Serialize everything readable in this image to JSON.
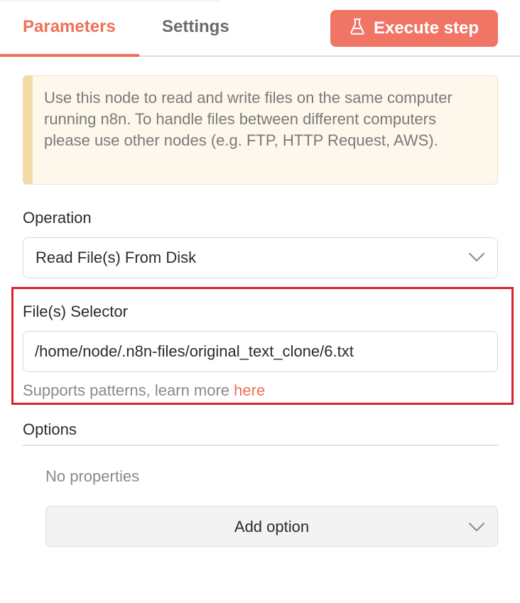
{
  "tabs": {
    "parameters": "Parameters",
    "settings": "Settings"
  },
  "execute_button": {
    "label": "Execute step",
    "icon": "flask-icon",
    "color": "#f07565"
  },
  "notice": {
    "text": "Use this node to read and write files on the same computer running n8n. To handle files between different computers please use other nodes (e.g. FTP, HTTP Request, AWS)."
  },
  "operation": {
    "label": "Operation",
    "value": "Read File(s) From Disk"
  },
  "file_selector": {
    "label": "File(s) Selector",
    "value": "/home/node/.n8n-files/original_text_clone/6.txt",
    "hint_prefix": "Supports patterns, learn more ",
    "hint_link": "here",
    "highlight_color": "#d9232f"
  },
  "options": {
    "label": "Options",
    "empty_text": "No properties",
    "add_button": "Add option"
  },
  "colors": {
    "accent": "#ef7157"
  }
}
